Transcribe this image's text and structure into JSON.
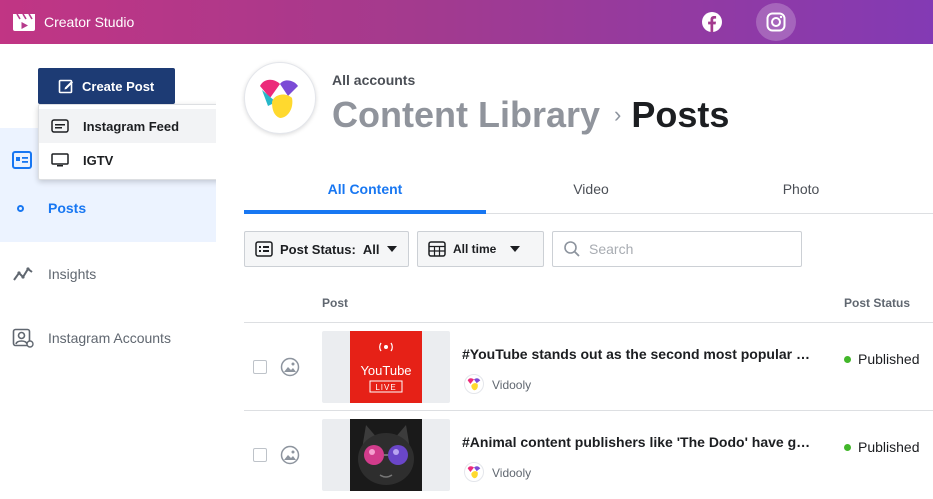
{
  "app": {
    "title": "Creator Studio"
  },
  "topbar": {
    "icons": [
      "facebook-icon",
      "instagram-icon"
    ]
  },
  "sidebar": {
    "create_label": "Create Post",
    "menu": [
      {
        "label": "Instagram Feed",
        "icon": "feed-icon"
      },
      {
        "label": "IGTV",
        "icon": "tv-icon"
      }
    ],
    "items": [
      {
        "label": "Posts",
        "active": true
      },
      {
        "label": "Insights",
        "icon": "insights-icon"
      },
      {
        "label": "Instagram Accounts",
        "icon": "accounts-icon"
      }
    ]
  },
  "header": {
    "account": "All accounts",
    "library": "Content Library",
    "separator": "›",
    "page": "Posts"
  },
  "tabs": [
    {
      "label": "All Content",
      "active": true
    },
    {
      "label": "Video"
    },
    {
      "label": "Photo"
    }
  ],
  "filters": {
    "status_label": "Post Status:",
    "status_value": "All",
    "time_label": "All time",
    "search_placeholder": "Search"
  },
  "table": {
    "columns": [
      "Post",
      "Post Status"
    ],
    "rows": [
      {
        "title": "#YouTube stands out as the second most popular platform",
        "account": "Vidooly",
        "status": "Published",
        "thumb_text_1": "YouTube",
        "thumb_text_2": "LIVE"
      },
      {
        "title": "#Animal content publishers like 'The Dodo' have gained popularity",
        "account": "Vidooly",
        "status": "Published"
      }
    ]
  },
  "colors": {
    "accent": "#1877f2",
    "create_button": "#1d3b74",
    "published": "#42b72a",
    "youtube_red": "#e62117"
  }
}
